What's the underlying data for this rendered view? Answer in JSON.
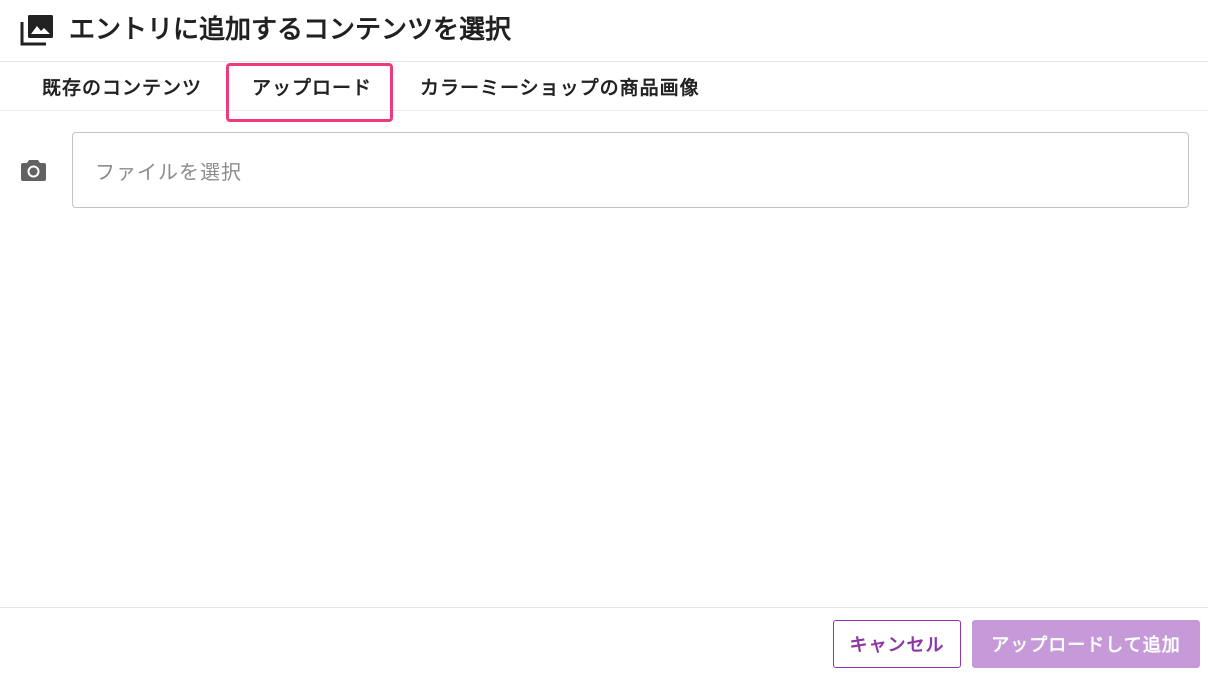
{
  "dialog": {
    "title": "エントリに追加するコンテンツを選択",
    "title_icon": "photo-library-icon"
  },
  "tabs": [
    {
      "label": "既存のコンテンツ",
      "active": false
    },
    {
      "label": "アップロード",
      "active": true
    },
    {
      "label": "カラーミーショップの商品画像",
      "active": false
    }
  ],
  "upload": {
    "icon": "camera-icon",
    "file_placeholder": "ファイルを選択"
  },
  "footer": {
    "cancel_label": "キャンセル",
    "submit_label": "アップロードして追加",
    "submit_disabled": true
  },
  "colors": {
    "highlight": "#ee3b7d",
    "accent": "#8e35a8",
    "accent_disabled": "#c69ad8"
  }
}
